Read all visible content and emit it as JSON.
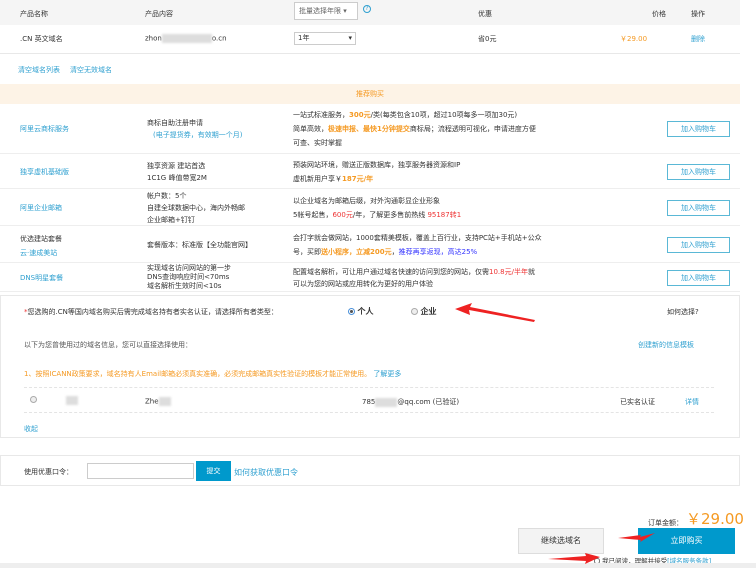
{
  "table": {
    "headers": {
      "name": "产品名称",
      "content": "产品内容",
      "batch_select": "批量选择年限",
      "discount": "优惠",
      "price": "价格",
      "action": "操作"
    },
    "row": {
      "name": ".CN 英文域名",
      "domain_prefix": "zhon",
      "domain_suffix": "o.cn",
      "years": "1年",
      "discount": "省0元",
      "price": "￥29.00",
      "delete": "删除"
    }
  },
  "links": {
    "clear_list": "清空域名列表",
    "clear_invalid": "清空无效域名"
  },
  "recommend": {
    "title": "推荐购买",
    "add_label": "加入购物车",
    "items": [
      {
        "name": "阿里云商标服务",
        "content": [
          "商标自助注册申请",
          "(电子提货券，有效期一个月)"
        ],
        "desc": [
          [
            "一站式标准服务，",
            "300元",
            "/类(每类包含10项，超过10项每多一项加30元)"
          ],
          [
            "简单高效，",
            "极速申报、最快1分钟提交",
            "商标局；流程透明可视化，申请进度方便"
          ],
          [
            "可查、实时掌握"
          ]
        ]
      },
      {
        "name": "独享虚机基础版",
        "content": [
          "独享资源 建站首选",
          "1C1G 峰值带宽2M"
        ],
        "desc": [
          [
            "预装网站环境，赠送正版数据库，独享服务器资源和IP"
          ],
          [
            "虚机新用户享￥",
            "187元/年"
          ]
        ]
      },
      {
        "name": "阿里企业邮箱",
        "content": [
          "帐户数：5个",
          "自建全球数据中心，海内外畅邮",
          "企业邮箱+钉钉"
        ],
        "desc": [
          [
            "以企业域名为邮箱后缀，对外沟通彰显企业形象"
          ],
          [
            "5帐号起售，",
            "600元",
            "/年，了解更多售前热线 ",
            "95187转1"
          ]
        ]
      },
      {
        "name": "优选建站套餐",
        "name2": "云·速成美站",
        "content": [
          "套餐版本：标准版【全功能官网】"
        ],
        "desc": [
          [
            "会打字就会做网站，1000套精美模板，覆盖上百行业，支持PC站+手机站+公众"
          ],
          [
            "号，买即",
            "送小程序，立减200元",
            "，",
            "推荐再享返现，高达25%"
          ]
        ]
      },
      {
        "name": "DNS明星套餐",
        "content": [
          "实现域名访问网站的第一步",
          "DNS查询响应时间<70ms",
          "域名解析生效时间<10s"
        ],
        "desc": [
          [
            "配置域名解析，可让用户通过域名快速的访问到您的网站，仅需",
            "10.8元/半年",
            "就"
          ],
          [
            "可以为您的网站或应用转化为更好的用户体验"
          ]
        ]
      }
    ]
  },
  "owner": {
    "prompt": "您选购的.CN等国内域名购买后需完成域名持有者实名认证，请选择所有者类型：",
    "required": "*",
    "personal": "个人",
    "enterprise": "企业",
    "how": "如何选择?",
    "template_hint": "以下为您曾使用过的域名信息，您可以直接选择使用：",
    "create_template": "创建新的信息模板",
    "notice": "1、按照ICANN政策要求，域名持有人Email邮箱必须真实准确，必须完成邮箱真实性验证的模板才能正常使用。",
    "learn_more": "了解更多",
    "entry": {
      "name_prefix": "Zhe",
      "email_prefix": "785",
      "email_suffix": "@qq.com (已验证)",
      "status": "已实名认证",
      "detail": "详情"
    },
    "collapse": "收起"
  },
  "coupon": {
    "label": "使用优惠口令：",
    "submit": "提交",
    "how": "如何获取优惠口令",
    "value": ""
  },
  "order": {
    "total_label": "订单金额：",
    "total": "￥29.00",
    "continue": "继续选域名",
    "buy": "立即购买",
    "agree": "我已阅读，理解并接受",
    "terms": "[域名服务条款]"
  },
  "colors": {
    "accent": "#0099cc",
    "orange": "#f59a23",
    "link": "#2fa0d0"
  }
}
